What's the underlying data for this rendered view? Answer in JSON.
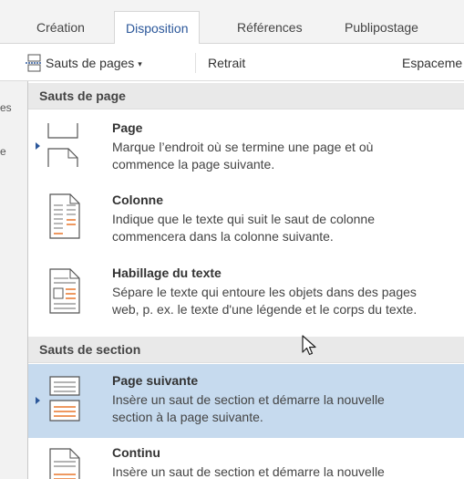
{
  "ribbon": {
    "tabs": [
      {
        "label": "Création"
      },
      {
        "label": "Disposition",
        "active": true
      },
      {
        "label": "Références"
      },
      {
        "label": "Publipostage"
      }
    ]
  },
  "toolbar": {
    "page_breaks_label": "Sauts de pages",
    "indent_label": "Retrait",
    "spacing_label": "Espaceme"
  },
  "left_strip": {
    "text1": "es",
    "text2": "e"
  },
  "menu": {
    "sections": [
      {
        "header": "Sauts de page",
        "items": [
          {
            "title": "Page",
            "description": [
              "Marque l’endroit où se termine une page et où",
              "commence la page suivante."
            ],
            "icon": "page-break-icon"
          },
          {
            "title": "Colonne",
            "description": [
              "Indique que le texte qui suit le saut de colonne",
              "commencera dans la colonne suivante."
            ],
            "icon": "column-break-icon"
          },
          {
            "title": "Habillage du texte",
            "description": [
              "Sépare le texte qui entoure les objets dans des pages",
              "web, p. ex. le texte d'une légende et le corps du texte."
            ],
            "icon": "text-wrapping-icon"
          }
        ]
      },
      {
        "header": "Sauts de section",
        "items": [
          {
            "title": "Page suivante",
            "description": [
              "Insère un saut de section et démarre la nouvelle",
              "section à la page suivante."
            ],
            "icon": "next-page-section-icon",
            "highlighted": true
          },
          {
            "title": "Continu",
            "description": [
              "Insère un saut de section et démarre la nouvelle"
            ],
            "icon": "continuous-section-icon"
          }
        ]
      }
    ]
  },
  "colors": {
    "accent": "#2b579a",
    "highlight": "#c6daee",
    "orange": "#e8762b"
  }
}
